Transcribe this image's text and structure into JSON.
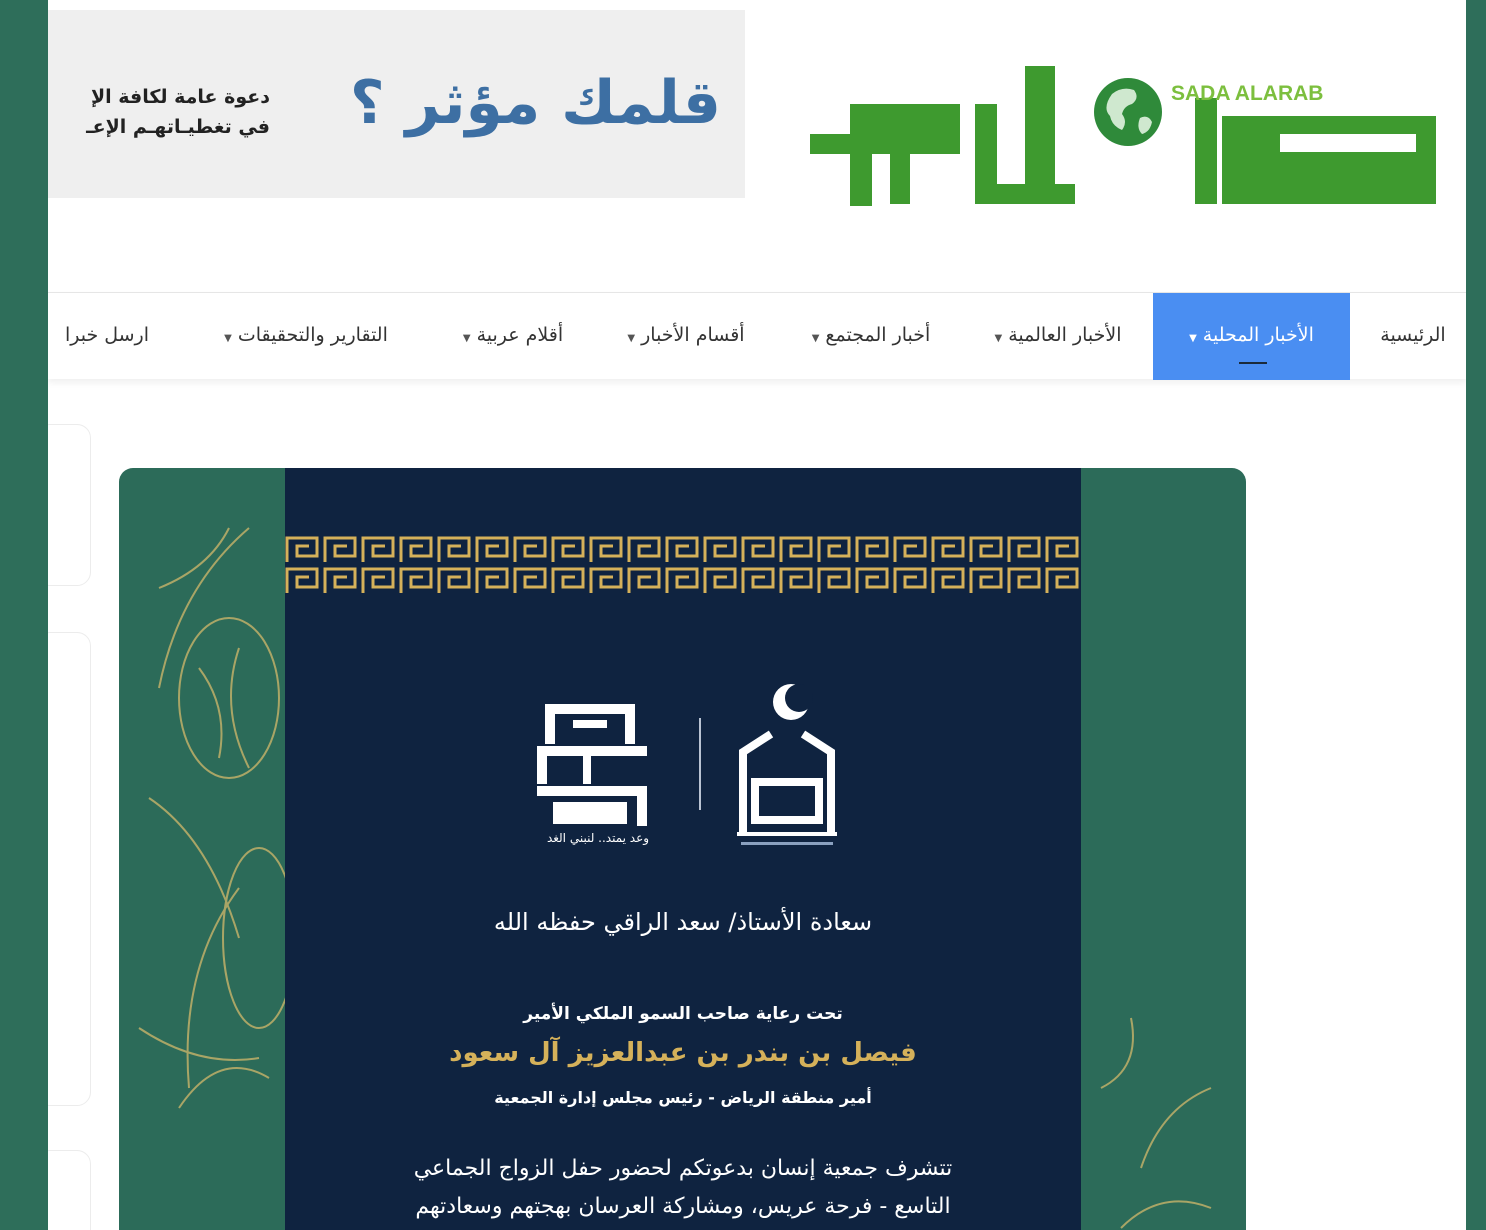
{
  "header": {
    "ad_headline": "قلمك مؤثر ؟",
    "ad_text_line1": "دعوة عامة لكافة الإ",
    "ad_text_line2": "في تغطيـاتهـم الإعـ",
    "logo_latin": "SADA ALARAB",
    "logo_arabic": "صدى العرب"
  },
  "nav": {
    "items": [
      {
        "label": "الرئيسية"
      },
      {
        "label": "الأخبار المحلية",
        "active": true
      },
      {
        "label": "الأخبار العالمية"
      },
      {
        "label": "أخبار المجتمع"
      },
      {
        "label": "أقسام الأخبار"
      },
      {
        "label": "أقلام عربية"
      },
      {
        "label": "التقارير والتحقيقات"
      },
      {
        "label": "ارسل خبرا"
      }
    ],
    "caret_icon": "caret-down-icon"
  },
  "invitation": {
    "guest_line": "سعادة الأستاذ/ سعد الراقي      حفظه الله",
    "patronage": "تحت رعاية صاحب السمو الملكي الأمير",
    "prince": "فيصل بن بندر بن عبدالعزيز آل سعود",
    "prince_title": "أمير منطقة الرياض - رئيس مجلس إدارة الجمعية",
    "body_line1": "تتشرف جمعية إنسان بدعوتكم لحضور حفل الزواج الجماعي",
    "body_line2": "التاسع - فرحة عريس، ومشاركة العرسان بهجتهم وسعادتهم",
    "logo_insan": "انسان",
    "logo_family_tagline": "وعد يمتد.. لنبني الغد"
  },
  "colors": {
    "outer_background": "#2e6e5a",
    "logo_green": "#3e9a2f",
    "nav_active": "#4a8ef2",
    "card_navy": "#0f2340",
    "card_gold": "#d5b15a"
  }
}
